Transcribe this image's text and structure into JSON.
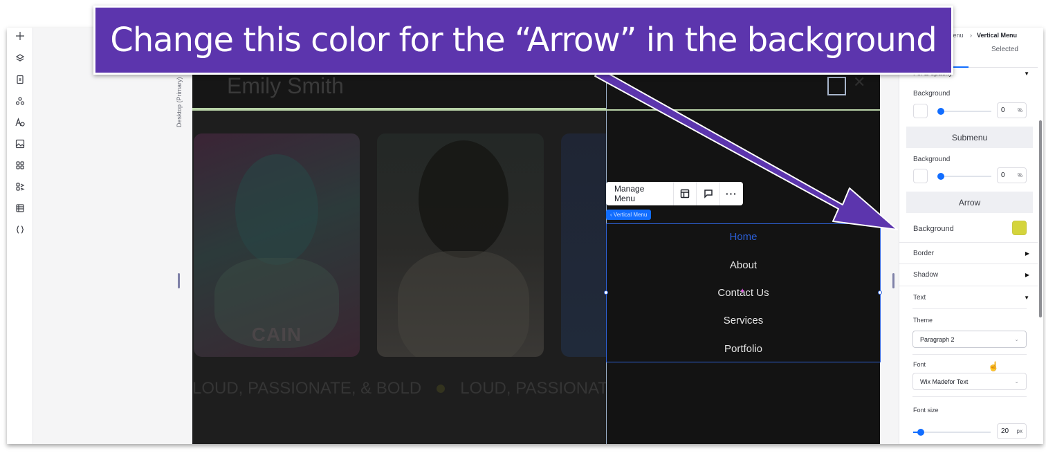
{
  "annotation": {
    "callout_text": "Change this color for the “Arrow” in the background",
    "color": "#5c35ad"
  },
  "left_toolbar": {
    "tools": [
      {
        "name": "add-icon"
      },
      {
        "name": "layers-icon"
      },
      {
        "name": "pages-icon"
      },
      {
        "name": "apps-connect-icon"
      },
      {
        "name": "text-theme-icon"
      },
      {
        "name": "media-icon"
      },
      {
        "name": "app-market-icon"
      },
      {
        "name": "business-apps-icon"
      },
      {
        "name": "cms-table-icon"
      },
      {
        "name": "code-icon"
      }
    ]
  },
  "canvas": {
    "breakpoint_label": "Desktop (Primary)",
    "site_title": "Emily Smith",
    "card_caption": "CAIN",
    "marquee": [
      "LOUD, PASSIONATE, & BOLD",
      "LOUD, PASSIONATE"
    ],
    "context_toolbar": {
      "manage_label": "Manage Menu",
      "layout_icon": "layout-icon",
      "comment_icon": "comment-icon",
      "more_label": "···"
    },
    "element_tag": "‹ Vertical Menu",
    "menu_items": [
      {
        "label": "Home",
        "active": true
      },
      {
        "label": "About",
        "active": false
      },
      {
        "label": "Contact Us",
        "active": false
      },
      {
        "label": "Services",
        "active": false
      },
      {
        "label": "Portfolio",
        "active": false
      }
    ],
    "active_color": "#2b5fd6"
  },
  "right_panel": {
    "breadcrumb_parent": "Menu",
    "breadcrumb_sep": "›",
    "breadcrumb_current": "Vertical Menu",
    "tab_selected": "Selected",
    "opacity_section": "Fill & opacity",
    "menu_bg_label": "Background",
    "menu_bg_opacity": "0",
    "percent_unit": "%",
    "submenu_header": "Submenu",
    "submenu_bg_label": "Background",
    "submenu_bg_opacity": "0",
    "arrow_header": "Arrow",
    "arrow_bg_label": "Background",
    "arrow_bg_color": "#d4d43c",
    "border_label": "Border",
    "shadow_label": "Shadow",
    "text_label": "Text",
    "theme_label": "Theme",
    "theme_value": "Paragraph 2",
    "font_label": "Font",
    "font_value": "Wix Madefor Text",
    "font_size_label": "Font size",
    "font_size_value": "20",
    "font_size_unit": "px",
    "font_size_fraction": 0.1
  }
}
